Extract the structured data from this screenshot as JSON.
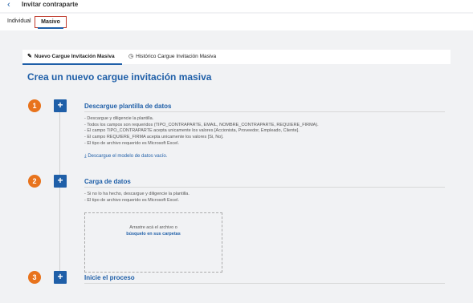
{
  "header": {
    "back_icon": "chevron-left-icon",
    "title": "Invitar contraparte"
  },
  "tabs": [
    {
      "label": "Individual",
      "active": false
    },
    {
      "label": "Masivo",
      "active": true
    }
  ],
  "subtabs": [
    {
      "label": "Nuevo Cargue Invitación Masiva",
      "icon": "pencil-icon",
      "active": true
    },
    {
      "label": "Histórico Cargue Invitación Masiva",
      "icon": "clock-icon",
      "active": false
    }
  ],
  "main_title": "Crea un nuevo cargue invitación masiva",
  "steps": [
    {
      "number": "1",
      "title": "Descargue plantilla de datos",
      "bullets": [
        "- Descargue y diligencie la plantilla.",
        "- Todos los campos son requeridos (TIPO_CONTRAPARTE, EMAIL, NOMBRE_CONTRAPARTE, REQUIERE_FIRMA).",
        "- El campo TIPO_CONTRAPARTE acepta unicamente los valores [Accionista, Proveedor, Empleado, Cliente].",
        "- El campo REQUIERE_FIRMA acepta unicamente los valores [Si, No].",
        "- El tipo de archivo requerido es Microsoft Excel."
      ],
      "link": "Descargue el modelo de datos vacío."
    },
    {
      "number": "2",
      "title": "Carga de datos",
      "bullets": [
        "- Si no lo ha hecho, descargue y diligencie la plantilla.",
        "- El tipo de archivo requerido es Microsoft Excel."
      ],
      "dropzone": {
        "line1": "Arrastre acá el archivo o",
        "line2": "búsquelo en sus carpetas"
      }
    },
    {
      "number": "3",
      "title": "Inicie el proceso"
    }
  ],
  "colors": {
    "accent": "#1f5fa8",
    "step_badge": "#e8731c",
    "active_tab_border": "#c0392b"
  }
}
